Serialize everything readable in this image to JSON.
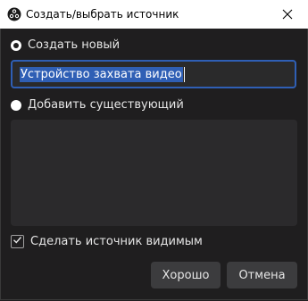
{
  "window": {
    "title": "Создать/выбрать источник",
    "icon": "obs-logo-icon",
    "close_icon": "close-icon"
  },
  "options": {
    "create_new_label": "Создать новый",
    "create_new_selected": true,
    "name_value": "Устройство захвата видео",
    "add_existing_label": "Добавить существующий",
    "add_existing_selected": false,
    "existing_items": []
  },
  "visibility": {
    "label": "Сделать источник видимым",
    "checked": true
  },
  "buttons": {
    "ok_label": "Хорошо",
    "cancel_label": "Отмена"
  },
  "colors": {
    "background": "#1f1e1f",
    "accent": "#2f5fb5",
    "button": "#3c3c3e"
  }
}
